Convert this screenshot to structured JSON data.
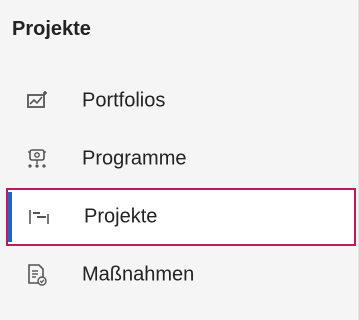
{
  "section": {
    "title": "Projekte"
  },
  "nav": {
    "items": [
      {
        "label": "Portfolios",
        "icon": "portfolio-icon",
        "selected": false
      },
      {
        "label": "Programme",
        "icon": "programme-icon",
        "selected": false
      },
      {
        "label": "Projekte",
        "icon": "project-timeline-icon",
        "selected": true
      },
      {
        "label": "Maßnahmen",
        "icon": "document-task-icon",
        "selected": false
      }
    ]
  },
  "colors": {
    "selection_border": "#c2185b",
    "selection_indicator": "#2563c9",
    "panel_background": "#f5f5f5"
  }
}
